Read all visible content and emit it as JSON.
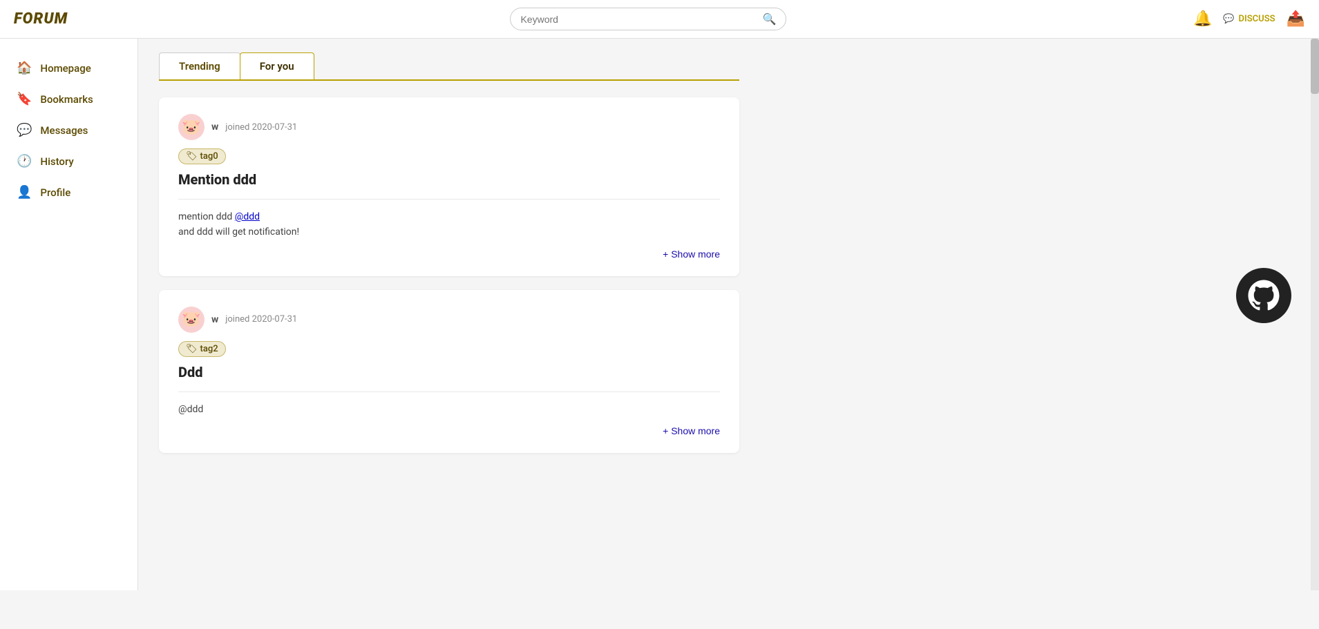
{
  "header": {
    "logo": "FORUM",
    "search": {
      "placeholder": "Keyword"
    },
    "discuss_label": "DISCUSS"
  },
  "sidebar": {
    "items": [
      {
        "id": "homepage",
        "label": "Homepage",
        "icon": "🏠"
      },
      {
        "id": "bookmarks",
        "label": "Bookmarks",
        "icon": "🔖"
      },
      {
        "id": "messages",
        "label": "Messages",
        "icon": "💬"
      },
      {
        "id": "history",
        "label": "History",
        "icon": "🕐"
      },
      {
        "id": "profile",
        "label": "Profile",
        "icon": "👤"
      }
    ]
  },
  "tabs": [
    {
      "id": "trending",
      "label": "Trending"
    },
    {
      "id": "for-you",
      "label": "For you"
    }
  ],
  "posts": [
    {
      "id": "post1",
      "avatar_emoji": "🐷",
      "author_letter": "w",
      "join_date": "joined 2020-07-31",
      "tag": "tag0",
      "title": "Mention ddd",
      "content_line1": "mention ddd",
      "mention": "@ddd",
      "content_line2": "and ddd will get notification!",
      "show_more_label": "+ Show more"
    },
    {
      "id": "post2",
      "avatar_emoji": "🐷",
      "author_letter": "w",
      "join_date": "joined 2020-07-31",
      "tag": "tag2",
      "title": "Ddd",
      "content_line1": "@ddd",
      "mention": "",
      "content_line2": "",
      "show_more_label": "+ Show more"
    }
  ]
}
